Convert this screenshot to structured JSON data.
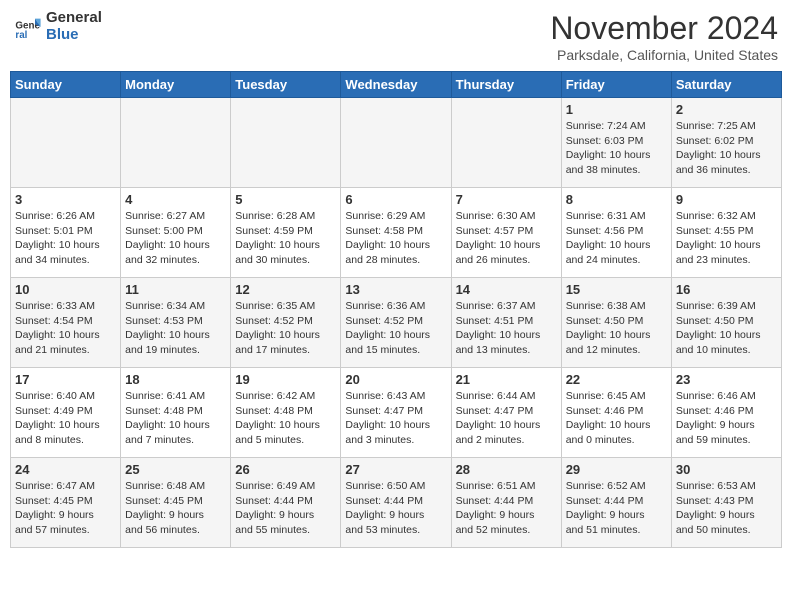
{
  "header": {
    "logo_line1": "General",
    "logo_line2": "Blue",
    "title": "November 2024",
    "subtitle": "Parksdale, California, United States"
  },
  "weekdays": [
    "Sunday",
    "Monday",
    "Tuesday",
    "Wednesday",
    "Thursday",
    "Friday",
    "Saturday"
  ],
  "weeks": [
    [
      {
        "day": "",
        "info": ""
      },
      {
        "day": "",
        "info": ""
      },
      {
        "day": "",
        "info": ""
      },
      {
        "day": "",
        "info": ""
      },
      {
        "day": "",
        "info": ""
      },
      {
        "day": "1",
        "info": "Sunrise: 7:24 AM\nSunset: 6:03 PM\nDaylight: 10 hours\nand 38 minutes."
      },
      {
        "day": "2",
        "info": "Sunrise: 7:25 AM\nSunset: 6:02 PM\nDaylight: 10 hours\nand 36 minutes."
      }
    ],
    [
      {
        "day": "3",
        "info": "Sunrise: 6:26 AM\nSunset: 5:01 PM\nDaylight: 10 hours\nand 34 minutes."
      },
      {
        "day": "4",
        "info": "Sunrise: 6:27 AM\nSunset: 5:00 PM\nDaylight: 10 hours\nand 32 minutes."
      },
      {
        "day": "5",
        "info": "Sunrise: 6:28 AM\nSunset: 4:59 PM\nDaylight: 10 hours\nand 30 minutes."
      },
      {
        "day": "6",
        "info": "Sunrise: 6:29 AM\nSunset: 4:58 PM\nDaylight: 10 hours\nand 28 minutes."
      },
      {
        "day": "7",
        "info": "Sunrise: 6:30 AM\nSunset: 4:57 PM\nDaylight: 10 hours\nand 26 minutes."
      },
      {
        "day": "8",
        "info": "Sunrise: 6:31 AM\nSunset: 4:56 PM\nDaylight: 10 hours\nand 24 minutes."
      },
      {
        "day": "9",
        "info": "Sunrise: 6:32 AM\nSunset: 4:55 PM\nDaylight: 10 hours\nand 23 minutes."
      }
    ],
    [
      {
        "day": "10",
        "info": "Sunrise: 6:33 AM\nSunset: 4:54 PM\nDaylight: 10 hours\nand 21 minutes."
      },
      {
        "day": "11",
        "info": "Sunrise: 6:34 AM\nSunset: 4:53 PM\nDaylight: 10 hours\nand 19 minutes."
      },
      {
        "day": "12",
        "info": "Sunrise: 6:35 AM\nSunset: 4:52 PM\nDaylight: 10 hours\nand 17 minutes."
      },
      {
        "day": "13",
        "info": "Sunrise: 6:36 AM\nSunset: 4:52 PM\nDaylight: 10 hours\nand 15 minutes."
      },
      {
        "day": "14",
        "info": "Sunrise: 6:37 AM\nSunset: 4:51 PM\nDaylight: 10 hours\nand 13 minutes."
      },
      {
        "day": "15",
        "info": "Sunrise: 6:38 AM\nSunset: 4:50 PM\nDaylight: 10 hours\nand 12 minutes."
      },
      {
        "day": "16",
        "info": "Sunrise: 6:39 AM\nSunset: 4:50 PM\nDaylight: 10 hours\nand 10 minutes."
      }
    ],
    [
      {
        "day": "17",
        "info": "Sunrise: 6:40 AM\nSunset: 4:49 PM\nDaylight: 10 hours\nand 8 minutes."
      },
      {
        "day": "18",
        "info": "Sunrise: 6:41 AM\nSunset: 4:48 PM\nDaylight: 10 hours\nand 7 minutes."
      },
      {
        "day": "19",
        "info": "Sunrise: 6:42 AM\nSunset: 4:48 PM\nDaylight: 10 hours\nand 5 minutes."
      },
      {
        "day": "20",
        "info": "Sunrise: 6:43 AM\nSunset: 4:47 PM\nDaylight: 10 hours\nand 3 minutes."
      },
      {
        "day": "21",
        "info": "Sunrise: 6:44 AM\nSunset: 4:47 PM\nDaylight: 10 hours\nand 2 minutes."
      },
      {
        "day": "22",
        "info": "Sunrise: 6:45 AM\nSunset: 4:46 PM\nDaylight: 10 hours\nand 0 minutes."
      },
      {
        "day": "23",
        "info": "Sunrise: 6:46 AM\nSunset: 4:46 PM\nDaylight: 9 hours\nand 59 minutes."
      }
    ],
    [
      {
        "day": "24",
        "info": "Sunrise: 6:47 AM\nSunset: 4:45 PM\nDaylight: 9 hours\nand 57 minutes."
      },
      {
        "day": "25",
        "info": "Sunrise: 6:48 AM\nSunset: 4:45 PM\nDaylight: 9 hours\nand 56 minutes."
      },
      {
        "day": "26",
        "info": "Sunrise: 6:49 AM\nSunset: 4:44 PM\nDaylight: 9 hours\nand 55 minutes."
      },
      {
        "day": "27",
        "info": "Sunrise: 6:50 AM\nSunset: 4:44 PM\nDaylight: 9 hours\nand 53 minutes."
      },
      {
        "day": "28",
        "info": "Sunrise: 6:51 AM\nSunset: 4:44 PM\nDaylight: 9 hours\nand 52 minutes."
      },
      {
        "day": "29",
        "info": "Sunrise: 6:52 AM\nSunset: 4:44 PM\nDaylight: 9 hours\nand 51 minutes."
      },
      {
        "day": "30",
        "info": "Sunrise: 6:53 AM\nSunset: 4:43 PM\nDaylight: 9 hours\nand 50 minutes."
      }
    ]
  ]
}
